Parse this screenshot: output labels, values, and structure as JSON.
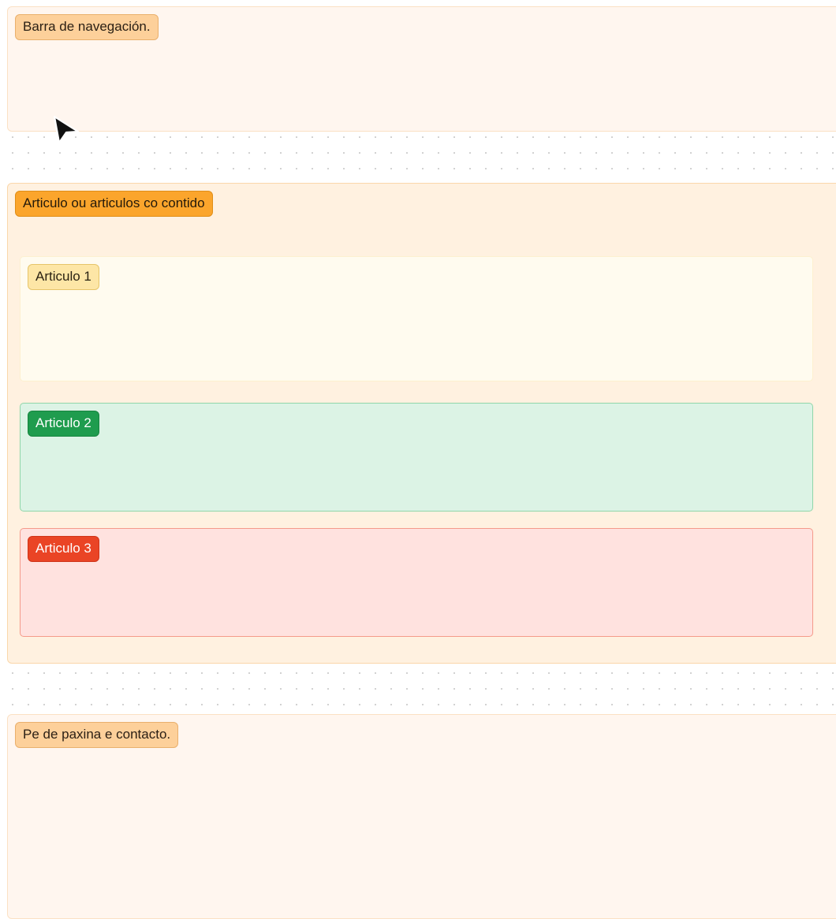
{
  "sections": {
    "nav": {
      "label": "Barra de navegación."
    },
    "articles": {
      "label": "Articulo ou articulos co contido",
      "items": [
        {
          "label": "Articulo 1"
        },
        {
          "label": "Articulo 2"
        },
        {
          "label": "Articulo 3"
        }
      ]
    },
    "footer": {
      "label": "Pe de paxina e contacto."
    }
  },
  "cursor": {
    "icon": "mouse-pointer-icon"
  }
}
